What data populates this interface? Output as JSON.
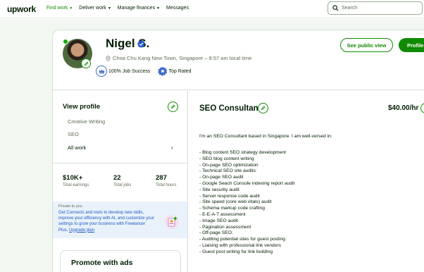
{
  "nav": {
    "logo": "upwork",
    "items": [
      {
        "label": "Find work",
        "active": true,
        "dropdown": true
      },
      {
        "label": "Deliver work",
        "active": false,
        "dropdown": true
      },
      {
        "label": "Manage finances",
        "active": false,
        "dropdown": true
      },
      {
        "label": "Messages",
        "active": false,
        "dropdown": false
      }
    ],
    "search_placeholder": "Search"
  },
  "profile": {
    "name": "Nigel S.",
    "location": "Choa Chu Kang New Town, Singapore – 8:57 am local time",
    "badges": [
      {
        "label": "100% Job Success",
        "icon": "crown-icon"
      },
      {
        "label": "Top Rated",
        "icon": "top-rated-icon"
      }
    ],
    "see_public_view": "See public view",
    "profile_settings": "Profile s"
  },
  "sidebar": {
    "view_profile": "View profile",
    "specializations": [
      "Creative Writing",
      "SEO",
      "All work"
    ],
    "stats": [
      {
        "value": "$10K+",
        "label": "Total earnings"
      },
      {
        "value": "22",
        "label": "Total jobs"
      },
      {
        "value": "287",
        "label": "Total hours"
      }
    ],
    "promo": {
      "tag": "Private to you",
      "text": "Get Connects and tools to develop new skills, improve your efficiency with AI, and customize your settings to grow your business with Freelancer Plus.",
      "link": "Upgrade plan"
    },
    "ads_title": "Promote with ads"
  },
  "main": {
    "title": "SEO Consultant",
    "rate": "$40.00/hr",
    "intro": "I'm an SEO Consultant based in Singapore. I am well-versed in:",
    "bullets": [
      "- Blog content SEO strategy development",
      "- SEO blog content writing",
      "- On-page SEO optimization",
      "- Technical SEO site audits:",
      "- On-page SEO audit",
      "- Google Seach Console indexing report audit",
      "- Site security audit",
      "- Server response code audit",
      "- Site speed (core web vitals) audit",
      "- Schema markup code crafting",
      "- E-E-A-T assessment",
      "- Image SEO audit",
      "- Pagination assessment",
      "- Off-page SEO:",
      "- Auditing potential sites for guest posting",
      "- Liaising with professional link vendors",
      "- Guest post writing for link building"
    ]
  },
  "colors": {
    "brand_green": "#108a00",
    "text": "#001e00",
    "muted": "#5e6d55",
    "link_blue": "#1f57c3",
    "badge_blue": "#3c6cc9"
  }
}
